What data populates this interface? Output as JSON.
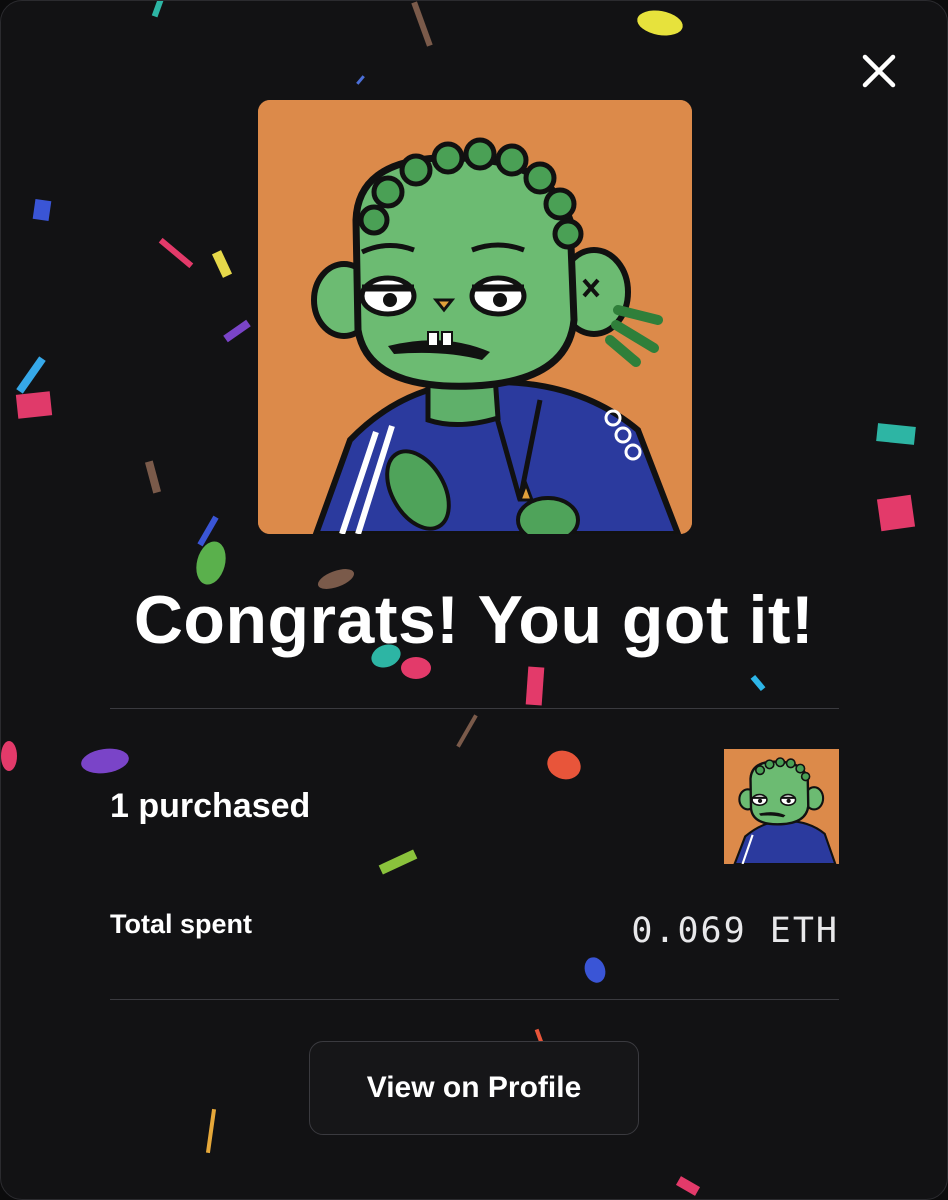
{
  "modal": {
    "headline": "Congrats! You got it!",
    "purchased_text": "1 purchased",
    "total_spent_label": "Total spent",
    "total_spent_value": "0.069 ETH",
    "view_profile_label": "View on Profile"
  },
  "icons": {
    "close": "close-icon",
    "hero": "nft-character-image",
    "thumbnail": "nft-thumbnail-image"
  },
  "colors": {
    "background": "#121214",
    "nft_background": "#dc8a4a",
    "text": "#ffffff",
    "divider": "#3a3a3f"
  }
}
